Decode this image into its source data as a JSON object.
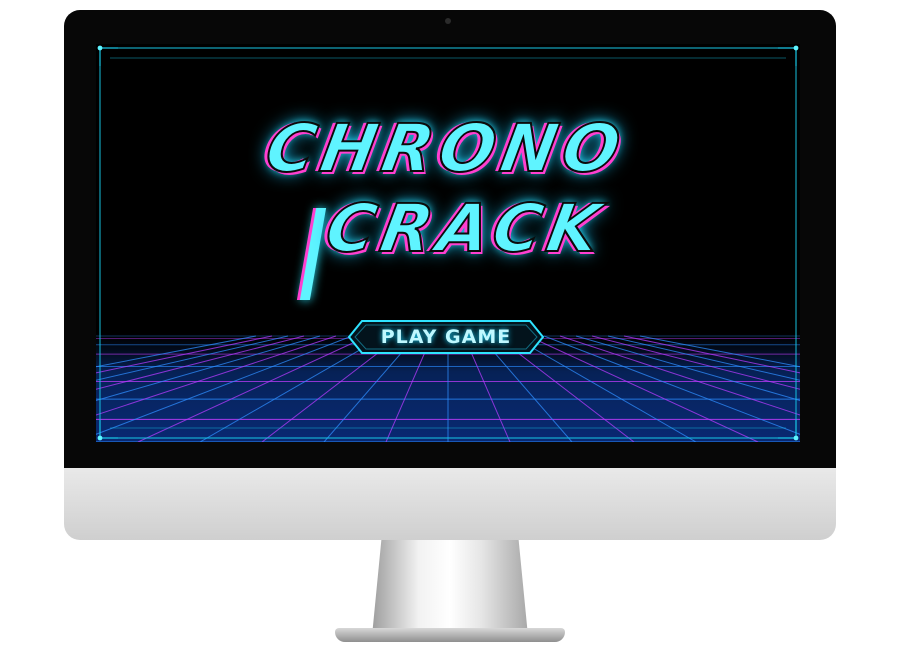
{
  "game": {
    "title_line1": "CHRONO",
    "title_line2": "CRACK",
    "play_button": "PLAY GAME"
  },
  "colors": {
    "neon_cyan": "#5ff4ff",
    "neon_magenta": "#ff3fd0",
    "grid_blue": "#1f6dff",
    "screen_bg": "#000000"
  },
  "icons": {
    "frame": "hud-corner-frame",
    "floor": "neon-grid-floor"
  }
}
